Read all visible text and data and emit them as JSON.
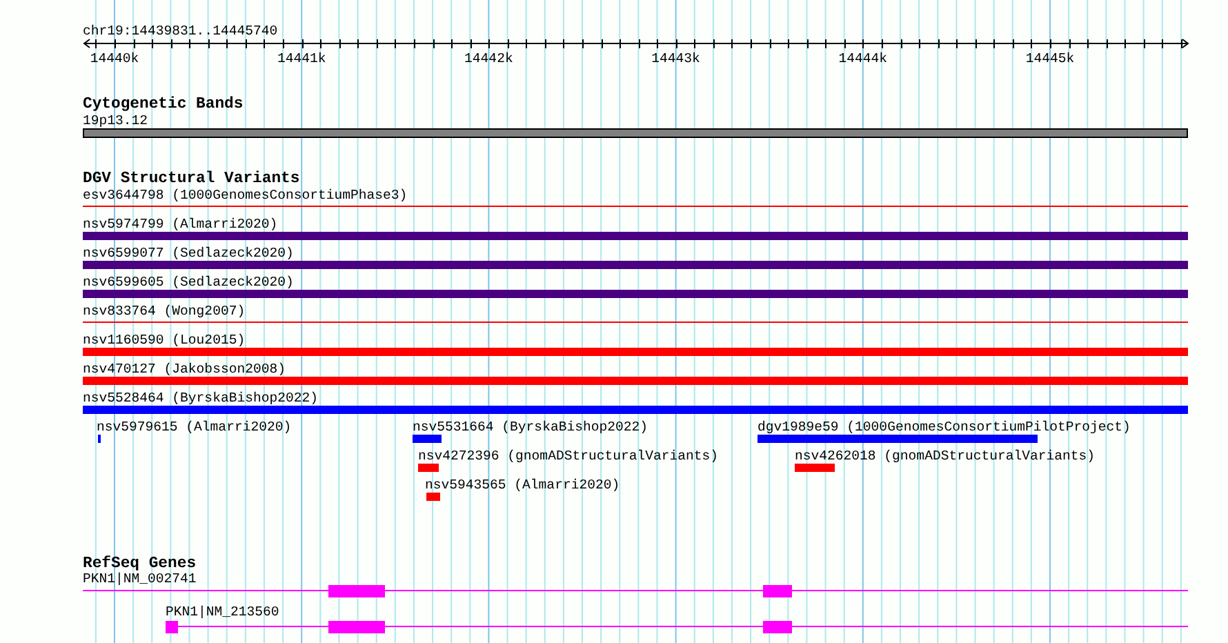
{
  "location": "chr19:14439831..14445740",
  "ruler": {
    "ticks": [
      "14440k",
      "14441k",
      "14442k",
      "14443k",
      "14444k",
      "14445k"
    ]
  },
  "tracks": [
    {
      "title": "Cytogenetic Bands",
      "kind": "bands",
      "features": [
        {
          "label": "19p13.12",
          "color": "#808080"
        }
      ]
    },
    {
      "title": "DGV Structural Variants",
      "kind": "variants",
      "features": [
        {
          "label": "esv3644798 (1000GenomesConsortiumPhase3)",
          "color": "#ff0000",
          "kind": "line"
        },
        {
          "label": "nsv5974799 (Almarri2020)",
          "color": "#4b0082",
          "kind": "bar"
        },
        {
          "label": "nsv6599077 (Sedlazeck2020)",
          "color": "#4b0082",
          "kind": "bar"
        },
        {
          "label": "nsv6599605 (Sedlazeck2020)",
          "color": "#4b0082",
          "kind": "bar"
        },
        {
          "label": "nsv833764 (Wong2007)",
          "color": "#ff0000",
          "kind": "line"
        },
        {
          "label": "nsv1160590 (Lou2015)",
          "color": "#ff0000",
          "kind": "bar"
        },
        {
          "label": "nsv470127 (Jakobsson2008)",
          "color": "#ff0000",
          "kind": "bar"
        },
        {
          "label": "nsv5528464 (ByrskaBishop2022)",
          "color": "#0000ff",
          "kind": "bar"
        },
        {
          "label": "nsv5979615 (Almarri2020)",
          "color": "#0000ff",
          "kind": "bar"
        },
        {
          "label": "nsv5531664 (ByrskaBishop2022)",
          "color": "#0000ff",
          "kind": "bar"
        },
        {
          "label": "dgv1989e59 (1000GenomesConsortiumPilotProject)",
          "color": "#0000ff",
          "kind": "bar"
        },
        {
          "label": "nsv4272396 (gnomADStructuralVariants)",
          "color": "#ff0000",
          "kind": "bar"
        },
        {
          "label": "nsv4262018 (gnomADStructuralVariants)",
          "color": "#ff0000",
          "kind": "bar"
        },
        {
          "label": "nsv5943565 (Almarri2020)",
          "color": "#ff0000",
          "kind": "bar"
        }
      ]
    },
    {
      "title": "RefSeq Genes",
      "kind": "genes",
      "features": [
        {
          "label": "PKN1|NM_002741",
          "kind": "transcript"
        },
        {
          "label": "PKN1|NM_213560",
          "kind": "transcript"
        }
      ]
    }
  ]
}
